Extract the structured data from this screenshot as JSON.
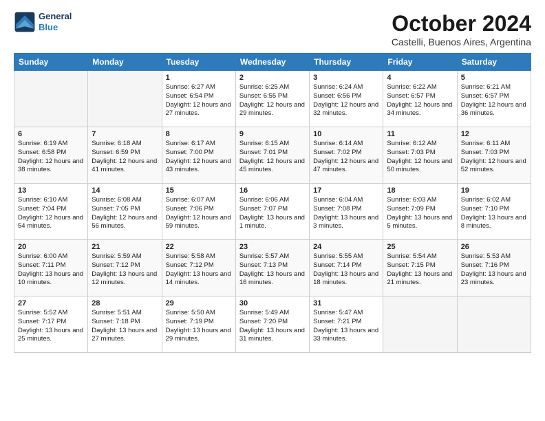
{
  "header": {
    "logo_line1": "General",
    "logo_line2": "Blue",
    "month": "October 2024",
    "location": "Castelli, Buenos Aires, Argentina"
  },
  "weekdays": [
    "Sunday",
    "Monday",
    "Tuesday",
    "Wednesday",
    "Thursday",
    "Friday",
    "Saturday"
  ],
  "weeks": [
    [
      {
        "day": "",
        "text": ""
      },
      {
        "day": "",
        "text": ""
      },
      {
        "day": "1",
        "text": "Sunrise: 6:27 AM\nSunset: 6:54 PM\nDaylight: 12 hours and 27 minutes."
      },
      {
        "day": "2",
        "text": "Sunrise: 6:25 AM\nSunset: 6:55 PM\nDaylight: 12 hours and 29 minutes."
      },
      {
        "day": "3",
        "text": "Sunrise: 6:24 AM\nSunset: 6:56 PM\nDaylight: 12 hours and 32 minutes."
      },
      {
        "day": "4",
        "text": "Sunrise: 6:22 AM\nSunset: 6:57 PM\nDaylight: 12 hours and 34 minutes."
      },
      {
        "day": "5",
        "text": "Sunrise: 6:21 AM\nSunset: 6:57 PM\nDaylight: 12 hours and 36 minutes."
      }
    ],
    [
      {
        "day": "6",
        "text": "Sunrise: 6:19 AM\nSunset: 6:58 PM\nDaylight: 12 hours and 38 minutes."
      },
      {
        "day": "7",
        "text": "Sunrise: 6:18 AM\nSunset: 6:59 PM\nDaylight: 12 hours and 41 minutes."
      },
      {
        "day": "8",
        "text": "Sunrise: 6:17 AM\nSunset: 7:00 PM\nDaylight: 12 hours and 43 minutes."
      },
      {
        "day": "9",
        "text": "Sunrise: 6:15 AM\nSunset: 7:01 PM\nDaylight: 12 hours and 45 minutes."
      },
      {
        "day": "10",
        "text": "Sunrise: 6:14 AM\nSunset: 7:02 PM\nDaylight: 12 hours and 47 minutes."
      },
      {
        "day": "11",
        "text": "Sunrise: 6:12 AM\nSunset: 7:03 PM\nDaylight: 12 hours and 50 minutes."
      },
      {
        "day": "12",
        "text": "Sunrise: 6:11 AM\nSunset: 7:03 PM\nDaylight: 12 hours and 52 minutes."
      }
    ],
    [
      {
        "day": "13",
        "text": "Sunrise: 6:10 AM\nSunset: 7:04 PM\nDaylight: 12 hours and 54 minutes."
      },
      {
        "day": "14",
        "text": "Sunrise: 6:08 AM\nSunset: 7:05 PM\nDaylight: 12 hours and 56 minutes."
      },
      {
        "day": "15",
        "text": "Sunrise: 6:07 AM\nSunset: 7:06 PM\nDaylight: 12 hours and 59 minutes."
      },
      {
        "day": "16",
        "text": "Sunrise: 6:06 AM\nSunset: 7:07 PM\nDaylight: 13 hours and 1 minute."
      },
      {
        "day": "17",
        "text": "Sunrise: 6:04 AM\nSunset: 7:08 PM\nDaylight: 13 hours and 3 minutes."
      },
      {
        "day": "18",
        "text": "Sunrise: 6:03 AM\nSunset: 7:09 PM\nDaylight: 13 hours and 5 minutes."
      },
      {
        "day": "19",
        "text": "Sunrise: 6:02 AM\nSunset: 7:10 PM\nDaylight: 13 hours and 8 minutes."
      }
    ],
    [
      {
        "day": "20",
        "text": "Sunrise: 6:00 AM\nSunset: 7:11 PM\nDaylight: 13 hours and 10 minutes."
      },
      {
        "day": "21",
        "text": "Sunrise: 5:59 AM\nSunset: 7:12 PM\nDaylight: 13 hours and 12 minutes."
      },
      {
        "day": "22",
        "text": "Sunrise: 5:58 AM\nSunset: 7:12 PM\nDaylight: 13 hours and 14 minutes."
      },
      {
        "day": "23",
        "text": "Sunrise: 5:57 AM\nSunset: 7:13 PM\nDaylight: 13 hours and 16 minutes."
      },
      {
        "day": "24",
        "text": "Sunrise: 5:55 AM\nSunset: 7:14 PM\nDaylight: 13 hours and 18 minutes."
      },
      {
        "day": "25",
        "text": "Sunrise: 5:54 AM\nSunset: 7:15 PM\nDaylight: 13 hours and 21 minutes."
      },
      {
        "day": "26",
        "text": "Sunrise: 5:53 AM\nSunset: 7:16 PM\nDaylight: 13 hours and 23 minutes."
      }
    ],
    [
      {
        "day": "27",
        "text": "Sunrise: 5:52 AM\nSunset: 7:17 PM\nDaylight: 13 hours and 25 minutes."
      },
      {
        "day": "28",
        "text": "Sunrise: 5:51 AM\nSunset: 7:18 PM\nDaylight: 13 hours and 27 minutes."
      },
      {
        "day": "29",
        "text": "Sunrise: 5:50 AM\nSunset: 7:19 PM\nDaylight: 13 hours and 29 minutes."
      },
      {
        "day": "30",
        "text": "Sunrise: 5:49 AM\nSunset: 7:20 PM\nDaylight: 13 hours and 31 minutes."
      },
      {
        "day": "31",
        "text": "Sunrise: 5:47 AM\nSunset: 7:21 PM\nDaylight: 13 hours and 33 minutes."
      },
      {
        "day": "",
        "text": ""
      },
      {
        "day": "",
        "text": ""
      }
    ]
  ]
}
